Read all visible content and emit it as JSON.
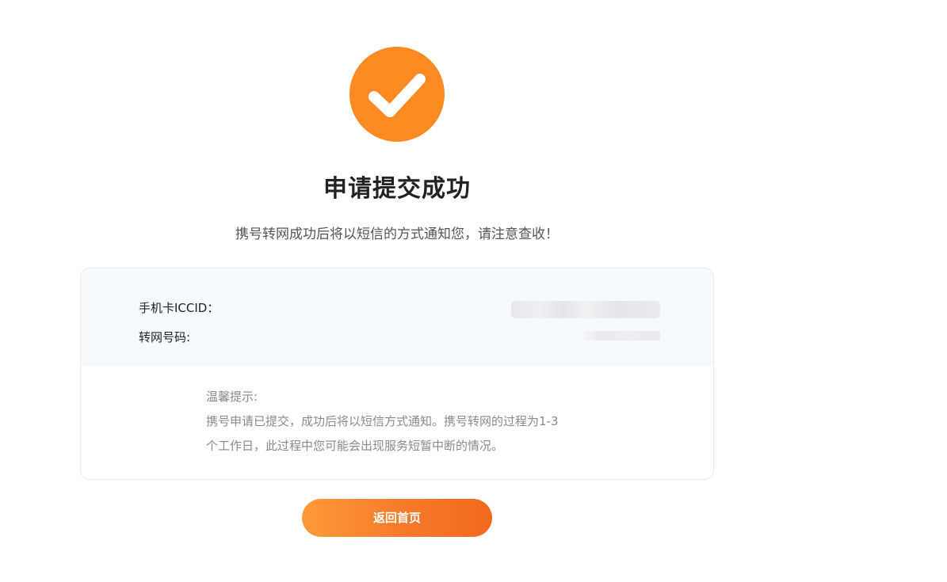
{
  "result": {
    "icon": "check-circle-icon",
    "icon_color": "#fd8a22",
    "title": "申请提交成功",
    "subtitle": "携号转网成功后将以短信的方式通知您，请注意查收！"
  },
  "info": {
    "iccid_label": "手机卡ICCID：",
    "number_label": "转网号码:"
  },
  "tips": {
    "title": "温馨提示:",
    "line1": "携号申请已提交，成功后将以短信方式通知。携号转网的过程为1-3",
    "line2": "个工作日，此过程中您可能会出现服务短暂中断的情况。"
  },
  "actions": {
    "home_label": "返回首页",
    "accent_color": "#f6792b"
  }
}
